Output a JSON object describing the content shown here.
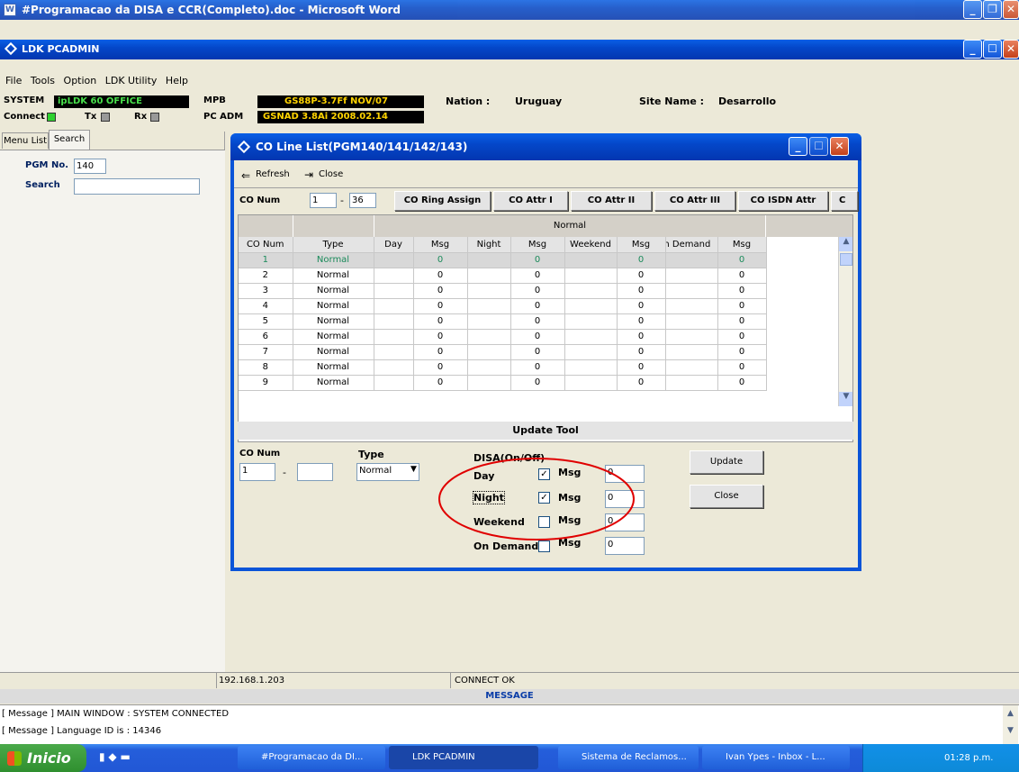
{
  "word_title": "#Programacao da DISA e CCR(Completo).doc - Microsoft Word",
  "app_title": "LDK PCADMIN",
  "menu": [
    "File",
    "Tools",
    "Option",
    "LDK Utility",
    "Help"
  ],
  "status": {
    "system_label": "SYSTEM",
    "system_value": "ipLDK 60 OFFICE",
    "mpb_label": "MPB",
    "mpb_value": "GS88P-3.7Ff NOV/07",
    "pcadm_label": "PC ADM",
    "pcadm_value": "GSNAD 3.8Ai 2008.02.14",
    "nation_label": "Nation :",
    "nation_value": "Uruguay",
    "site_label": "Site Name :",
    "site_value": "Desarrollo",
    "connect": "Connect",
    "tx": "Tx",
    "rx": "Rx"
  },
  "left": {
    "tabs": [
      "Menu List",
      "Search"
    ],
    "pgm_label": "PGM No.",
    "pgm_value": "140",
    "search_label": "Search",
    "search_value": ""
  },
  "dialog": {
    "title": "CO Line List(PGM140/141/142/143)",
    "refresh": "Refresh",
    "close": "Close",
    "co_num_label": "CO Num",
    "from": "1",
    "to": "36",
    "buttons": [
      "CO Ring Assign",
      "CO Attr I",
      "CO Attr II",
      "CO Attr III",
      "CO ISDN Attr",
      "C"
    ],
    "group_header": "Normal",
    "columns": [
      "CO Num",
      "Type",
      "Day",
      "Msg",
      "Night",
      "Msg",
      "Weekend",
      "Msg",
      "On Demand",
      "Msg"
    ],
    "rows": [
      [
        "1",
        "Normal",
        "",
        "0",
        "",
        "0",
        "",
        "0",
        "",
        "0"
      ],
      [
        "2",
        "Normal",
        "",
        "0",
        "",
        "0",
        "",
        "0",
        "",
        "0"
      ],
      [
        "3",
        "Normal",
        "",
        "0",
        "",
        "0",
        "",
        "0",
        "",
        "0"
      ],
      [
        "4",
        "Normal",
        "",
        "0",
        "",
        "0",
        "",
        "0",
        "",
        "0"
      ],
      [
        "5",
        "Normal",
        "",
        "0",
        "",
        "0",
        "",
        "0",
        "",
        "0"
      ],
      [
        "6",
        "Normal",
        "",
        "0",
        "",
        "0",
        "",
        "0",
        "",
        "0"
      ],
      [
        "7",
        "Normal",
        "",
        "0",
        "",
        "0",
        "",
        "0",
        "",
        "0"
      ],
      [
        "8",
        "Normal",
        "",
        "0",
        "",
        "0",
        "",
        "0",
        "",
        "0"
      ],
      [
        "9",
        "Normal",
        "",
        "0",
        "",
        "0",
        "",
        "0",
        "",
        "0"
      ]
    ],
    "update_tool": {
      "title": "Update Tool",
      "co_num_label": "CO Num",
      "co_from": "1",
      "co_to": "",
      "type_label": "Type",
      "type_value": "Normal",
      "disa_label": "DISA(On/Off)",
      "day": "Day",
      "night": "Night",
      "weekend": "Weekend",
      "ondemand": "On Demand",
      "msg": "Msg",
      "day_msg": "0",
      "night_msg": "0",
      "weekend_msg": "0",
      "ondemand_msg": "0",
      "update_btn": "Update",
      "close_btn": "Close"
    }
  },
  "footer": {
    "ip": "192.168.1.203",
    "conn": "CONNECT OK",
    "message_title": "MESSAGE",
    "messages": [
      "[ Message ] MAIN WINDOW : SYSTEM CONNECTED",
      "[ Message ] Language ID is  : 14346"
    ]
  },
  "taskbar": {
    "start": "Inicio",
    "items": [
      "#Programacao da DI...",
      "LDK PCADMIN",
      "Sistema de Reclamos...",
      "Ivan Ypes - Inbox - L..."
    ],
    "clock": "01:28 p.m."
  },
  "colors": {
    "title_blue": "#0a5fe6",
    "highlight_row": "#d8d8d8",
    "status_black": "#000000",
    "status_yellow": "#ffd400",
    "annotation_red": "#e00000"
  }
}
